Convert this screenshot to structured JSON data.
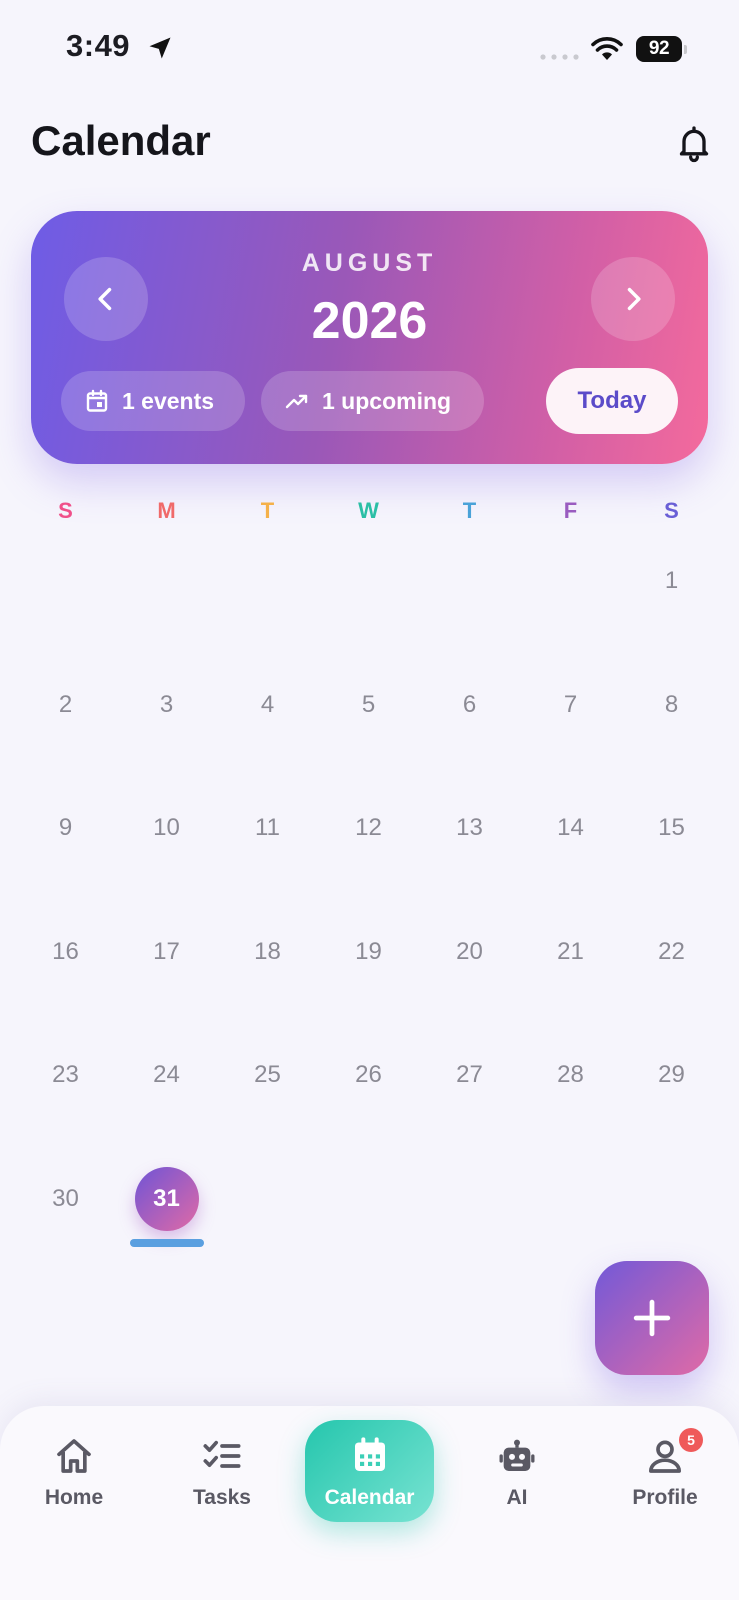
{
  "status_bar": {
    "time": "3:49",
    "battery": "92"
  },
  "header": {
    "title": "Calendar"
  },
  "month_card": {
    "month": "AUGUST",
    "year": "2026",
    "events_chip": "1 events",
    "upcoming_chip": "1 upcoming",
    "today_button": "Today",
    "gradient_colors": [
      "#6e5ce6",
      "#f46a9c"
    ]
  },
  "calendar": {
    "weekdays": [
      {
        "label": "S",
        "color": "#f0508a"
      },
      {
        "label": "M",
        "color": "#f06a6a"
      },
      {
        "label": "T",
        "color": "#f5b14a"
      },
      {
        "label": "W",
        "color": "#2bbfa6"
      },
      {
        "label": "T",
        "color": "#4aa2d8"
      },
      {
        "label": "F",
        "color": "#9a5cc0"
      },
      {
        "label": "S",
        "color": "#6a5fd6"
      }
    ],
    "first_weekday_index": 6,
    "days_in_month": 31,
    "selected_day": 31,
    "event_days": [
      31
    ]
  },
  "fab": {
    "icon": "plus-icon"
  },
  "bottom_nav": {
    "items": [
      {
        "label": "Home",
        "icon": "home-icon"
      },
      {
        "label": "Tasks",
        "icon": "tasks-icon"
      },
      {
        "label": "Calendar",
        "icon": "calendar-icon",
        "active": true
      },
      {
        "label": "AI",
        "icon": "robot-icon"
      },
      {
        "label": "Profile",
        "icon": "person-icon",
        "badge": "5"
      }
    ],
    "accent_color": "#25c6ad"
  }
}
